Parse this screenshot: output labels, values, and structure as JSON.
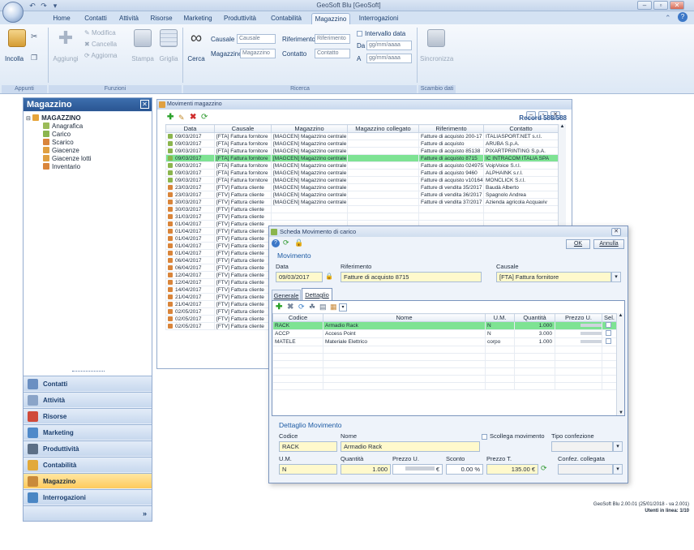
{
  "window": {
    "title": "GeoSoft Blu [GeoSoft]"
  },
  "ribbon": {
    "tabs": [
      "Home",
      "Contatti",
      "Attività",
      "Risorse",
      "Marketing",
      "Produttività",
      "Contabilità",
      "Magazzino",
      "Interrogazioni"
    ],
    "active_tab": "Magazzino",
    "appunti": {
      "incolla": "Incolla",
      "group": "Appunti"
    },
    "funzioni": {
      "aggiungi": "Aggiungi",
      "modifica": "Modifica",
      "cancella": "Cancella",
      "aggiorna": "Aggiorna",
      "stampa": "Stampa",
      "griglia": "Griglia",
      "group": "Funzioni"
    },
    "ricerca": {
      "cerca": "Cerca",
      "causale_label": "Causale",
      "causale_placeholder": "Causale",
      "magazzino_label": "Magazzino",
      "magazzino_placeholder": "Magazzino",
      "riferimento_label": "Riferimento",
      "riferimento_placeholder": "Riferimento",
      "contatto_label": "Contatto",
      "contatto_placeholder": "Contatto",
      "intervallo_label": "Intervallo data",
      "da_label": "Da",
      "a_label": "A",
      "date_placeholder": "gg/mm/aaaa",
      "group": "Ricerca"
    },
    "scambio": {
      "sincronizza": "Sincronizza",
      "group": "Scambio dati"
    }
  },
  "left_panel": {
    "title": "Magazzino",
    "tree": {
      "root": "MAGAZZINO",
      "children": [
        "Anagrafica",
        "Carico",
        "Scarico",
        "Giacenze",
        "Giacenze lotti",
        "Inventario"
      ]
    },
    "nav": [
      "Contatti",
      "Attività",
      "Risorse",
      "Marketing",
      "Produttività",
      "Contabilità",
      "Magazzino",
      "Interrogazioni"
    ],
    "active_nav": "Magazzino"
  },
  "grid_window": {
    "title": "Movimenti magazzino",
    "record_count": "Record 588/588",
    "columns": [
      "Data",
      "Causale",
      "Magazzino",
      "Magazzino collegato",
      "Riferimento",
      "Contatto"
    ],
    "rows": [
      [
        "09/03/2017",
        "[FTA] Fattura fornitore",
        "[MAGCEN] Magazzino centrale",
        "",
        "Fatture di acquisto 200-17",
        "ITALIASPORT.NET s.r.l."
      ],
      [
        "09/03/2017",
        "[FTA] Fattura fornitore",
        "[MAGCEN] Magazzino centrale",
        "",
        "Fatture di acquisto",
        "ARUBA S.p.A."
      ],
      [
        "09/03/2017",
        "[FTA] Fattura fornitore",
        "[MAGCEN] Magazzino centrale",
        "",
        "Fatture di acquisto 85138",
        "PIXARTPRINTING S.p.A."
      ],
      [
        "09/03/2017",
        "[FTA] Fattura fornitore",
        "[MAGCEN] Magazzino centrale",
        "",
        "Fatture di acquisto 8715",
        "IC INTRACOM ITALIA SPA"
      ],
      [
        "09/03/2017",
        "[FTA] Fattura fornitore",
        "[MAGCEN] Magazzino centrale",
        "",
        "Fatture di acquisto 024975",
        "VoipVoice S.r.l."
      ],
      [
        "09/03/2017",
        "[FTA] Fattura fornitore",
        "[MAGCEN] Magazzino centrale",
        "",
        "Fatture di acquisto 9460",
        "ALPHAINK s.r.l."
      ],
      [
        "09/03/2017",
        "[FTA] Fattura fornitore",
        "[MAGCEN] Magazzino centrale",
        "",
        "Fatture di acquisto v10164",
        "MONCLICK S.r.l."
      ],
      [
        "23/03/2017",
        "[FTV] Fattura cliente",
        "[MAGCEN] Magazzino centrale",
        "",
        "Fatture di vendita 35/2017",
        "Baudà Alberto"
      ],
      [
        "23/03/2017",
        "[FTV] Fattura cliente",
        "[MAGCEN] Magazzino centrale",
        "",
        "Fatture di vendita 36/2017",
        "Spagnolo Andrea"
      ],
      [
        "30/03/2017",
        "[FTV] Fattura cliente",
        "[MAGCEN] Magazzino centrale",
        "",
        "Fatture di vendita 37/2017",
        "Azienda agricola Acquaviv"
      ],
      [
        "30/03/2017",
        "[FTV] Fattura cliente",
        "",
        "",
        "",
        ""
      ],
      [
        "31/03/2017",
        "[FTV] Fattura cliente",
        "",
        "",
        "",
        ""
      ],
      [
        "01/04/2017",
        "[FTV] Fattura cliente",
        "",
        "",
        "",
        ""
      ],
      [
        "01/04/2017",
        "[FTV] Fattura cliente",
        "",
        "",
        "",
        ""
      ],
      [
        "01/04/2017",
        "[FTV] Fattura cliente",
        "",
        "",
        "",
        ""
      ],
      [
        "01/04/2017",
        "[FTV] Fattura cliente",
        "",
        "",
        "",
        ""
      ],
      [
        "01/04/2017",
        "[FTV] Fattura cliente",
        "",
        "",
        "",
        ""
      ],
      [
        "06/04/2017",
        "[FTV] Fattura cliente",
        "",
        "",
        "",
        ""
      ],
      [
        "06/04/2017",
        "[FTV] Fattura cliente",
        "",
        "",
        "",
        ""
      ],
      [
        "12/04/2017",
        "[FTV] Fattura cliente",
        "",
        "",
        "",
        ""
      ],
      [
        "12/04/2017",
        "[FTV] Fattura cliente",
        "",
        "",
        "",
        ""
      ],
      [
        "14/04/2017",
        "[FTV] Fattura cliente",
        "",
        "",
        "",
        ""
      ],
      [
        "21/04/2017",
        "[FTV] Fattura cliente",
        "",
        "",
        "",
        ""
      ],
      [
        "21/04/2017",
        "[FTV] Fattura cliente",
        "",
        "",
        "",
        ""
      ],
      [
        "02/05/2017",
        "[FTV] Fattura cliente",
        "",
        "",
        "",
        ""
      ],
      [
        "02/05/2017",
        "[FTV] Fattura cliente",
        "",
        "",
        "",
        ""
      ],
      [
        "02/05/2017",
        "[FTV] Fattura cliente",
        "",
        "",
        "",
        ""
      ]
    ],
    "selected_row": 3
  },
  "dialog": {
    "title": "Scheda Movimento di carico",
    "ok": "OK",
    "annulla": "Annulla",
    "movimento_section": "Movimento",
    "data_label": "Data",
    "data_value": "09/03/2017",
    "riferimento_label": "Riferimento",
    "riferimento_value": "Fatture di acquisto 8715",
    "causale_label": "Causale",
    "causale_value": "[FTA] Fattura fornitore",
    "tabs": [
      "Generale",
      "Dettaglio"
    ],
    "active_tab": "Dettaglio",
    "detail_columns": [
      "Codice",
      "Nome",
      "U.M.",
      "Quantità",
      "Prezzo U.",
      "Sel."
    ],
    "detail_rows": [
      {
        "codice": "RACK",
        "nome": "Armadio Rack",
        "um": "N",
        "quantita": "1.000"
      },
      {
        "codice": "ACCP",
        "nome": "Access Point",
        "um": "N",
        "quantita": "3.000"
      },
      {
        "codice": "MATELE",
        "nome": "Materiale Elettrico",
        "um": "corpo",
        "quantita": "1.000"
      }
    ],
    "dettaglio_section": "Dettaglio Movimento",
    "codice_label": "Codice",
    "codice_value": "RACK",
    "nome_label": "Nome",
    "nome_value": "Armadio Rack",
    "scollega_label": "Scollega movimento",
    "tipo_confezione_label": "Tipo confezione",
    "um_label": "U.M.",
    "um_value": "N",
    "quantita_label": "Quantità",
    "quantita_value": "1.000",
    "prezzo_u_label": "Prezzo U.",
    "sconto_label": "Sconto",
    "sconto_value": "0.00 %",
    "prezzo_t_label": "Prezzo T.",
    "prezzo_t_value": "135.00 €",
    "confez_label": "Confez. collegata"
  },
  "status": {
    "version": "GeoSoft Blu 2.00.01 (25/01/2018 - va 2.001)",
    "users": "Utenti in linea: 1/10"
  },
  "colors": {
    "accent": "#2a5592",
    "selection": "#7ee393",
    "field_bg": "#fff9cc",
    "active_nav": "#ffca5c"
  }
}
